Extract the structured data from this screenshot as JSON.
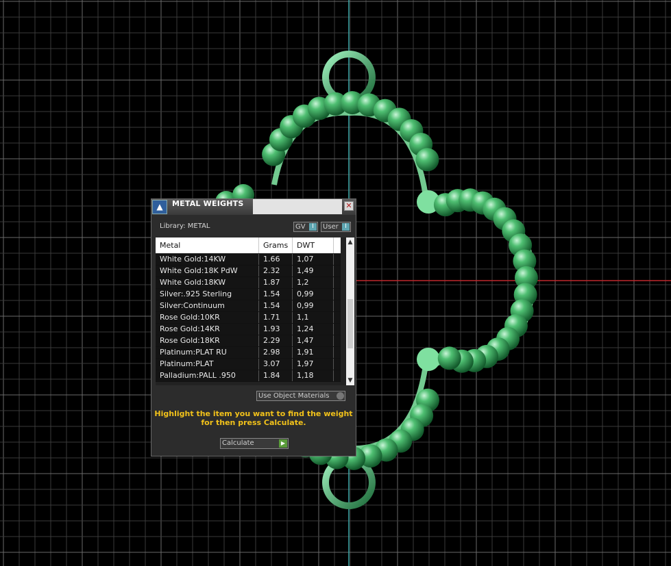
{
  "panel": {
    "title": "METAL WEIGHTS",
    "close_glyph": "✕",
    "library_label": "Library: METAL",
    "toggles": [
      {
        "label": "GV",
        "indicator": "I"
      },
      {
        "label": "User",
        "indicator": "I"
      }
    ],
    "columns": [
      "Metal",
      "Grams",
      "DWT"
    ],
    "rows": [
      {
        "metal": "White Gold:14KW",
        "grams": "1.66",
        "dwt": "1,07"
      },
      {
        "metal": "White Gold:18K PdW",
        "grams": "2.32",
        "dwt": "1,49"
      },
      {
        "metal": "White Gold:18KW",
        "grams": "1.87",
        "dwt": "1,2"
      },
      {
        "metal": "Silver:.925 Sterling",
        "grams": "1.54",
        "dwt": "0,99"
      },
      {
        "metal": "Silver:Continuum",
        "grams": "1.54",
        "dwt": "0,99"
      },
      {
        "metal": "Rose Gold:10KR",
        "grams": "1.71",
        "dwt": "1,1"
      },
      {
        "metal": "Rose Gold:14KR",
        "grams": "1.93",
        "dwt": "1,24"
      },
      {
        "metal": "Rose Gold:18KR",
        "grams": "2.29",
        "dwt": "1,47"
      },
      {
        "metal": "Platinum:PLAT RU",
        "grams": "2.98",
        "dwt": "1,91"
      },
      {
        "metal": "Platinum:PLAT",
        "grams": "3.07",
        "dwt": "1,97"
      },
      {
        "metal": "Palladium:PALL .950",
        "grams": "1.84",
        "dwt": "1,18"
      }
    ],
    "use_object_materials_label": "Use Object Materials",
    "hint_line1": "Highlight the item you want to find the weight",
    "hint_line2": "for then press Calculate.",
    "calculate_label": "Calculate",
    "scroll_up_glyph": "▲",
    "scroll_down_glyph": "▼"
  },
  "colors": {
    "background": "#000000",
    "grid": "#3a3a3a",
    "axis_vertical": "#3fa9a9",
    "axis_horizontal": "#c0282d",
    "jewel_green": "#2f9a4f",
    "jewel_light": "#7fe0a0",
    "hint": "#f2c21a"
  },
  "viewport": {
    "icons": [
      "app-logo-icon",
      "close-icon",
      "scroll-up-icon",
      "scroll-down-icon",
      "play-icon"
    ]
  }
}
